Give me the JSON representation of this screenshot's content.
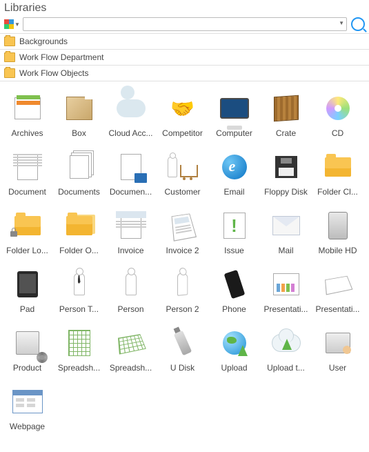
{
  "title": "Libraries",
  "search": {
    "value": "",
    "placeholder": ""
  },
  "sections": [
    {
      "label": "Backgrounds"
    },
    {
      "label": "Work Flow Department"
    },
    {
      "label": "Work Flow Objects"
    }
  ],
  "items": [
    {
      "label": "Archives",
      "icon": "archives-icon"
    },
    {
      "label": "Box",
      "icon": "box-icon"
    },
    {
      "label": "Cloud Acc...",
      "icon": "cloud-account-icon"
    },
    {
      "label": "Competitor",
      "icon": "competitor-icon"
    },
    {
      "label": "Computer",
      "icon": "computer-icon"
    },
    {
      "label": "Crate",
      "icon": "crate-icon"
    },
    {
      "label": "CD",
      "icon": "cd-icon"
    },
    {
      "label": "Document",
      "icon": "document-icon"
    },
    {
      "label": "Documents",
      "icon": "documents-icon"
    },
    {
      "label": "Documen...",
      "icon": "document-folder-icon"
    },
    {
      "label": "Customer",
      "icon": "customer-icon"
    },
    {
      "label": "Email",
      "icon": "email-icon"
    },
    {
      "label": "Floppy Disk",
      "icon": "floppy-disk-icon"
    },
    {
      "label": "Folder Cl...",
      "icon": "folder-closed-icon"
    },
    {
      "label": "Folder Lo...",
      "icon": "folder-locked-icon"
    },
    {
      "label": "Folder O...",
      "icon": "folder-open-icon"
    },
    {
      "label": "Invoice",
      "icon": "invoice-icon"
    },
    {
      "label": "Invoice 2",
      "icon": "invoice-2-icon"
    },
    {
      "label": "Issue",
      "icon": "issue-icon"
    },
    {
      "label": "Mail",
      "icon": "mail-icon"
    },
    {
      "label": "Mobile HD",
      "icon": "mobile-hd-icon"
    },
    {
      "label": "Pad",
      "icon": "pad-icon"
    },
    {
      "label": "Person T...",
      "icon": "person-tie-icon"
    },
    {
      "label": "Person",
      "icon": "person-icon"
    },
    {
      "label": "Person 2",
      "icon": "person-2-icon"
    },
    {
      "label": "Phone",
      "icon": "phone-icon"
    },
    {
      "label": "Presentati...",
      "icon": "presentation-icon"
    },
    {
      "label": "Presentati...",
      "icon": "presentation-2-icon"
    },
    {
      "label": "Product",
      "icon": "product-icon"
    },
    {
      "label": "Spreadsh...",
      "icon": "spreadsheet-icon"
    },
    {
      "label": "Spreadsh...",
      "icon": "spreadsheet-2-icon"
    },
    {
      "label": "U Disk",
      "icon": "u-disk-icon"
    },
    {
      "label": "Upload",
      "icon": "upload-icon"
    },
    {
      "label": "Upload t...",
      "icon": "upload-cloud-icon"
    },
    {
      "label": "User",
      "icon": "user-icon"
    },
    {
      "label": "Webpage",
      "icon": "webpage-icon"
    }
  ]
}
